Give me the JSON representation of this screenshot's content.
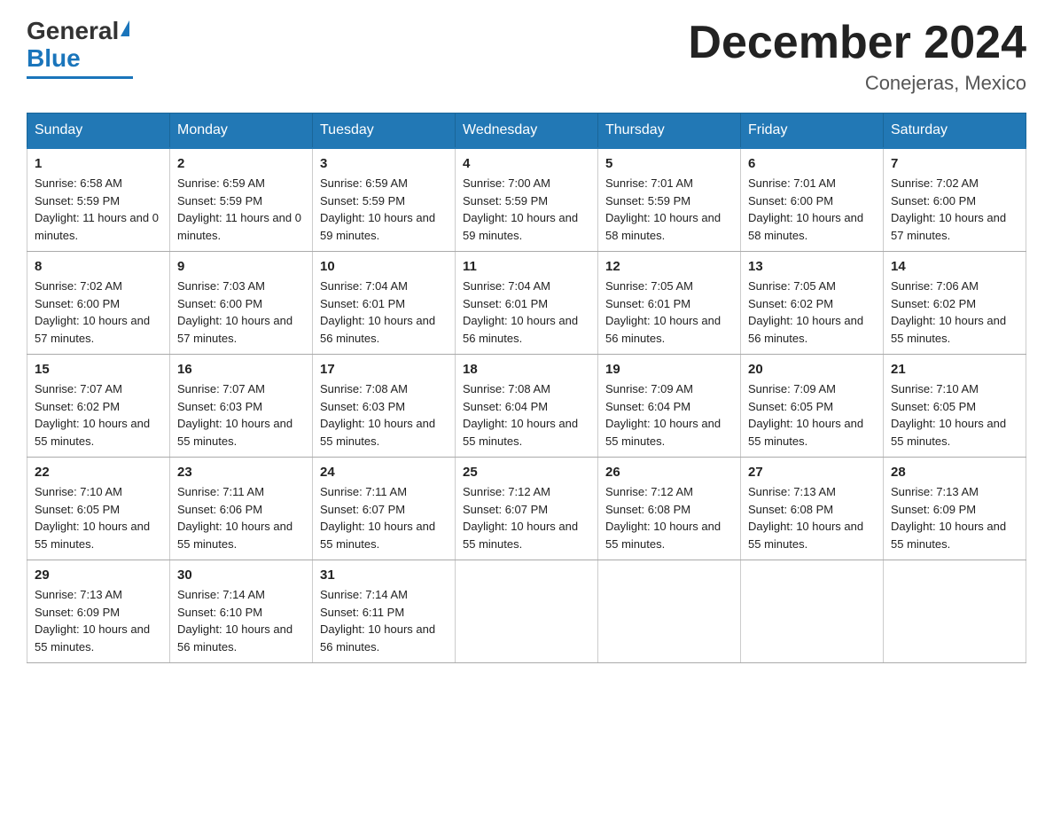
{
  "logo": {
    "general": "General",
    "blue": "Blue"
  },
  "title": "December 2024",
  "location": "Conejeras, Mexico",
  "days_of_week": [
    "Sunday",
    "Monday",
    "Tuesday",
    "Wednesday",
    "Thursday",
    "Friday",
    "Saturday"
  ],
  "weeks": [
    [
      {
        "day": "1",
        "sunrise": "6:58 AM",
        "sunset": "5:59 PM",
        "daylight": "11 hours and 0 minutes."
      },
      {
        "day": "2",
        "sunrise": "6:59 AM",
        "sunset": "5:59 PM",
        "daylight": "11 hours and 0 minutes."
      },
      {
        "day": "3",
        "sunrise": "6:59 AM",
        "sunset": "5:59 PM",
        "daylight": "10 hours and 59 minutes."
      },
      {
        "day": "4",
        "sunrise": "7:00 AM",
        "sunset": "5:59 PM",
        "daylight": "10 hours and 59 minutes."
      },
      {
        "day": "5",
        "sunrise": "7:01 AM",
        "sunset": "5:59 PM",
        "daylight": "10 hours and 58 minutes."
      },
      {
        "day": "6",
        "sunrise": "7:01 AM",
        "sunset": "6:00 PM",
        "daylight": "10 hours and 58 minutes."
      },
      {
        "day": "7",
        "sunrise": "7:02 AM",
        "sunset": "6:00 PM",
        "daylight": "10 hours and 57 minutes."
      }
    ],
    [
      {
        "day": "8",
        "sunrise": "7:02 AM",
        "sunset": "6:00 PM",
        "daylight": "10 hours and 57 minutes."
      },
      {
        "day": "9",
        "sunrise": "7:03 AM",
        "sunset": "6:00 PM",
        "daylight": "10 hours and 57 minutes."
      },
      {
        "day": "10",
        "sunrise": "7:04 AM",
        "sunset": "6:01 PM",
        "daylight": "10 hours and 56 minutes."
      },
      {
        "day": "11",
        "sunrise": "7:04 AM",
        "sunset": "6:01 PM",
        "daylight": "10 hours and 56 minutes."
      },
      {
        "day": "12",
        "sunrise": "7:05 AM",
        "sunset": "6:01 PM",
        "daylight": "10 hours and 56 minutes."
      },
      {
        "day": "13",
        "sunrise": "7:05 AM",
        "sunset": "6:02 PM",
        "daylight": "10 hours and 56 minutes."
      },
      {
        "day": "14",
        "sunrise": "7:06 AM",
        "sunset": "6:02 PM",
        "daylight": "10 hours and 55 minutes."
      }
    ],
    [
      {
        "day": "15",
        "sunrise": "7:07 AM",
        "sunset": "6:02 PM",
        "daylight": "10 hours and 55 minutes."
      },
      {
        "day": "16",
        "sunrise": "7:07 AM",
        "sunset": "6:03 PM",
        "daylight": "10 hours and 55 minutes."
      },
      {
        "day": "17",
        "sunrise": "7:08 AM",
        "sunset": "6:03 PM",
        "daylight": "10 hours and 55 minutes."
      },
      {
        "day": "18",
        "sunrise": "7:08 AM",
        "sunset": "6:04 PM",
        "daylight": "10 hours and 55 minutes."
      },
      {
        "day": "19",
        "sunrise": "7:09 AM",
        "sunset": "6:04 PM",
        "daylight": "10 hours and 55 minutes."
      },
      {
        "day": "20",
        "sunrise": "7:09 AM",
        "sunset": "6:05 PM",
        "daylight": "10 hours and 55 minutes."
      },
      {
        "day": "21",
        "sunrise": "7:10 AM",
        "sunset": "6:05 PM",
        "daylight": "10 hours and 55 minutes."
      }
    ],
    [
      {
        "day": "22",
        "sunrise": "7:10 AM",
        "sunset": "6:05 PM",
        "daylight": "10 hours and 55 minutes."
      },
      {
        "day": "23",
        "sunrise": "7:11 AM",
        "sunset": "6:06 PM",
        "daylight": "10 hours and 55 minutes."
      },
      {
        "day": "24",
        "sunrise": "7:11 AM",
        "sunset": "6:07 PM",
        "daylight": "10 hours and 55 minutes."
      },
      {
        "day": "25",
        "sunrise": "7:12 AM",
        "sunset": "6:07 PM",
        "daylight": "10 hours and 55 minutes."
      },
      {
        "day": "26",
        "sunrise": "7:12 AM",
        "sunset": "6:08 PM",
        "daylight": "10 hours and 55 minutes."
      },
      {
        "day": "27",
        "sunrise": "7:13 AM",
        "sunset": "6:08 PM",
        "daylight": "10 hours and 55 minutes."
      },
      {
        "day": "28",
        "sunrise": "7:13 AM",
        "sunset": "6:09 PM",
        "daylight": "10 hours and 55 minutes."
      }
    ],
    [
      {
        "day": "29",
        "sunrise": "7:13 AM",
        "sunset": "6:09 PM",
        "daylight": "10 hours and 55 minutes."
      },
      {
        "day": "30",
        "sunrise": "7:14 AM",
        "sunset": "6:10 PM",
        "daylight": "10 hours and 56 minutes."
      },
      {
        "day": "31",
        "sunrise": "7:14 AM",
        "sunset": "6:11 PM",
        "daylight": "10 hours and 56 minutes."
      },
      null,
      null,
      null,
      null
    ]
  ]
}
